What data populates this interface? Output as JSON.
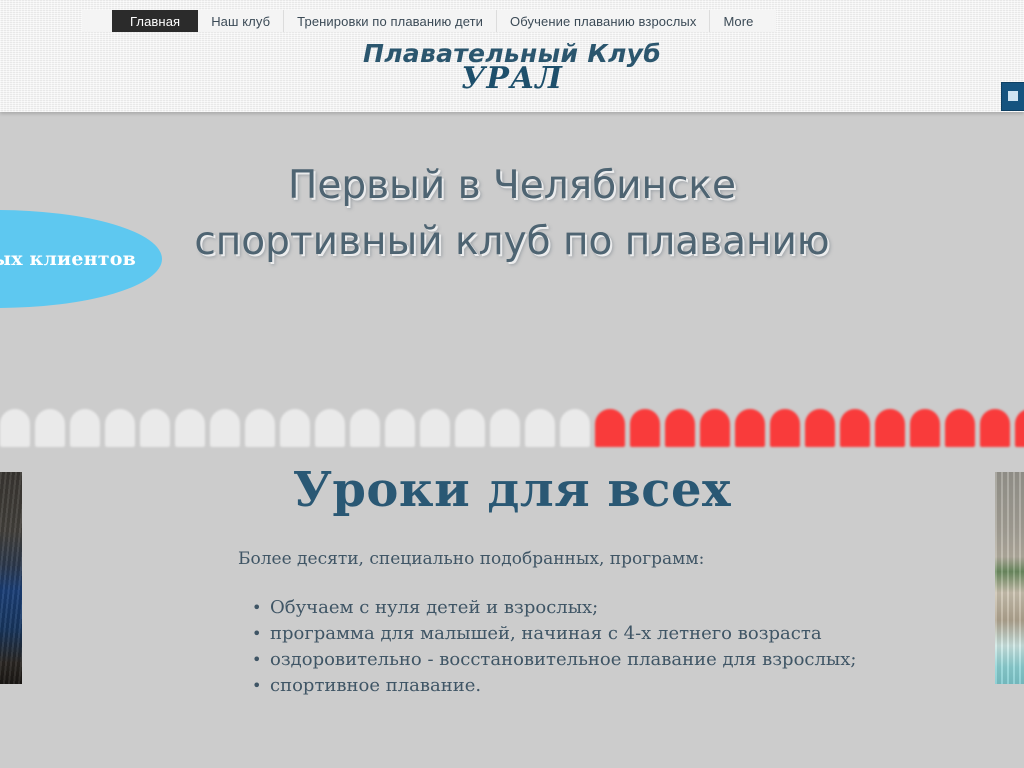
{
  "nav": {
    "items": [
      {
        "label": "Главная",
        "active": true
      },
      {
        "label": "Наш клуб",
        "active": false
      },
      {
        "label": "Тренировки по плаванию дети",
        "active": false
      },
      {
        "label": "Обучение плаванию взрослых",
        "active": false
      },
      {
        "label": "More",
        "active": false
      }
    ]
  },
  "logo": {
    "line1": "Плавательный Клуб",
    "line2": "УРАЛ"
  },
  "hero": {
    "line1": "Первый в Челябинске",
    "line2": "спортивный клуб по плаванию"
  },
  "badge": {
    "text": "ных клиентов"
  },
  "caps": {
    "total": 30,
    "white_count": 17,
    "red_count": 13,
    "white_color": "#eaeaea",
    "red_color": "#f93b3b"
  },
  "lessons": {
    "title": "Уроки для всех",
    "lead": "Более десяти,  специально подобранных, программ:",
    "bullets": [
      "Обучаем с нуля детей и взрослых;",
      "программа для малышей, начиная с 4-х летнего возраста",
      "оздоровительно - восстановительное плавание для взрослых;",
      "спортивное плавание."
    ]
  },
  "colors": {
    "header_bg": "#eeeeee",
    "page_bg": "#cccccc",
    "brand_blue": "#2a5874",
    "accent_cyan": "#5ec8f0",
    "accent_red": "#f93b3b",
    "nav_active_bg": "#2b2b2b",
    "text_body": "#3f5565"
  }
}
